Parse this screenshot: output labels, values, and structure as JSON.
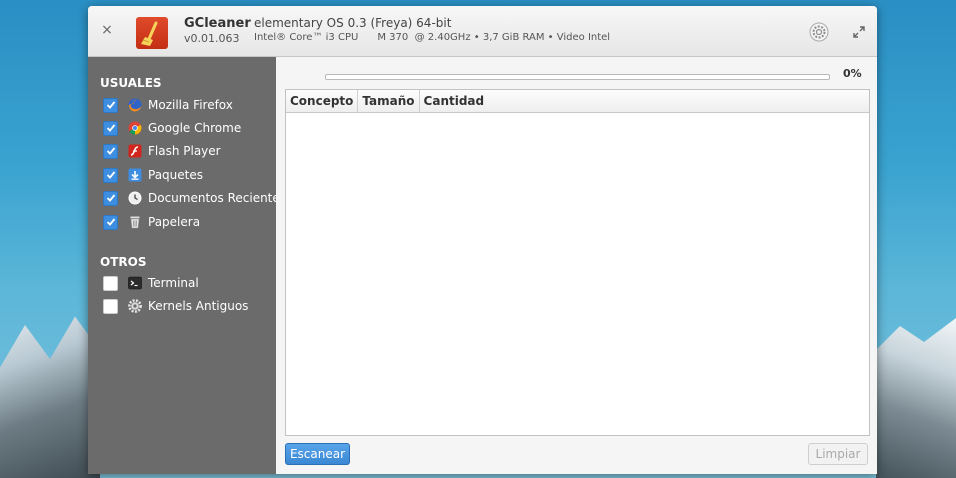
{
  "app": {
    "name": "GCleaner",
    "version": "v0.01.063",
    "os": "elementary OS 0.3 (Freya) 64-bit",
    "sysinfo": "Intel® Core™ i3 CPU      M 370  @ 2.40GHz • 3,7 GiB RAM • Video Intel"
  },
  "titlebar": {
    "close_icon": "×",
    "settings_icon": "gear-icon",
    "maximize_icon": "maximize-icon"
  },
  "sidebar": {
    "usuales_title": "USUALES",
    "usuales": [
      {
        "label": "Mozilla Firefox",
        "checked": true,
        "icon": "firefox-icon"
      },
      {
        "label": "Google Chrome",
        "checked": true,
        "icon": "chrome-icon"
      },
      {
        "label": "Flash Player",
        "checked": true,
        "icon": "flash-player-icon"
      },
      {
        "label": "Paquetes",
        "checked": true,
        "icon": "package-download-icon"
      },
      {
        "label": "Documentos Recientes",
        "checked": true,
        "icon": "recent-documents-icon"
      },
      {
        "label": "Papelera",
        "checked": true,
        "icon": "trash-icon"
      }
    ],
    "otros_title": "OTROS",
    "otros": [
      {
        "label": "Terminal",
        "checked": false,
        "icon": "terminal-icon"
      },
      {
        "label": "Kernels Antiguos",
        "checked": false,
        "icon": "gear-icon"
      }
    ]
  },
  "progress": {
    "value": 0,
    "label": "0%"
  },
  "table": {
    "columns": [
      "Concepto",
      "Tamaño",
      "Cantidad"
    ],
    "rows": []
  },
  "buttons": {
    "scan": "Escanear",
    "clean": "Limpiar"
  },
  "colors": {
    "accent": "#3d8ee0",
    "sidebar_bg": "#6b6b6b"
  }
}
